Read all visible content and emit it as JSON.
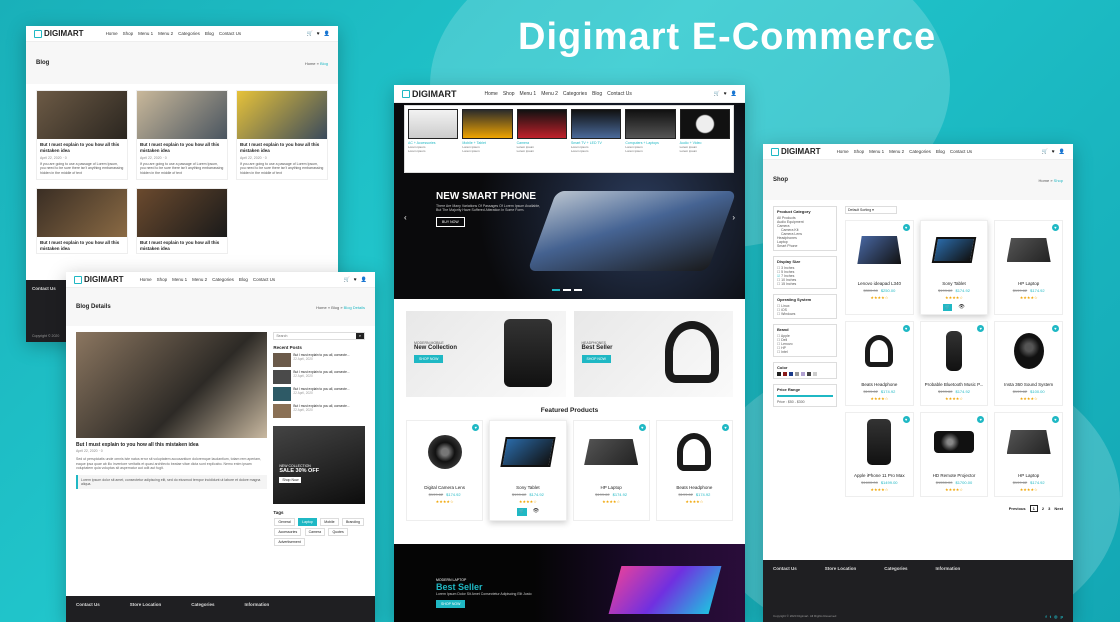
{
  "hero_title": "Digimart E-Commerce",
  "brand": "DIGIMART",
  "colors": {
    "accent": "#1fb8c4",
    "dark": "#1f1f22"
  },
  "nav": {
    "items": [
      "Home",
      "Shop",
      "Menu 1",
      "Menu 2",
      "Categories",
      "Blog",
      "Contact Us"
    ]
  },
  "blog_panel": {
    "heading": "Blog",
    "crumb_home": "Home",
    "crumb_current": "Blog",
    "post_title": "But I must explain to you how all this mistaken idea",
    "post_date": "April 22, 2020",
    "post_comments": "0",
    "post_excerpt": "If you are going to use a passage of Lorem Ipsum, you need to be sure there isn't anything embarrassing hidden in the middle of text",
    "footer_contact": "Contact Us",
    "copyright": "Copyright © 2020"
  },
  "detail_panel": {
    "heading": "Blog Details",
    "crumb_home": "Home",
    "crumb_mid": "Blog",
    "crumb_current": "Blog Details",
    "search_placeholder": "Search",
    "recent_posts_label": "Recent Posts",
    "recent_title": "But I must explain to you all, consecte...",
    "recent_date": "22 April, 2020",
    "post_title": "But I must explain to you how all this mistaken idea",
    "post_date": "April 22, 2020",
    "post_comments": "0",
    "body": "Sed ut perspiciatis unde omnis iste natus error sit voluptatem accusantium doloremque laudantium, totam rem aperiam, eaque ipsa quae ab illo inventore veritatis et quasi architecto beatae vitae dicta sunt explicabo. Nemo enim ipsam voluptatem quia voluptas sit aspernatur aut odit aut fugit.",
    "quote": "Lorem ipsum dolor sit amet, consectetur adipiscing elit, sed do eiusmod tempor incididunt ut labore et dolore magna aliqua.",
    "ad_small": "NEW COLLECTION",
    "ad_big": "SALE 30% OFF",
    "ad_btn": "Shop Now",
    "tags_label": "Tags",
    "tags": [
      "General",
      "Laptop",
      "Mobile",
      "Branding",
      "Accessories",
      "Camera",
      "Quotes",
      "Advertisement"
    ],
    "footer": [
      "Contact Us",
      "Store Location",
      "Categories",
      "Information"
    ]
  },
  "home_panel": {
    "mega": [
      "AC + Accessories",
      "Mobile + Tablet",
      "Camera",
      "Smart TV + LED TV",
      "Computers + Laptops",
      "Audio + Video"
    ],
    "mega_link": "Lorem ipsum",
    "slider_title": "NEW SMART PHONE",
    "slider_sub": "There Are Many Variations Of Passages Of Lorem Ipsum Available, But The Majority Have Suffered Alteration In Some Form.",
    "slider_btn": "BUY NOW",
    "promo1_small": "MODERN MOBILE",
    "promo1_big": "New Collection",
    "promo2_small": "HEADPHONES",
    "promo2_big": "Best Seller",
    "promo_btn": "SHOP NOW",
    "featured_label": "Featured Products",
    "products": [
      {
        "name": "Digital Camera Lens",
        "old": "$199.62",
        "price": "$174.92"
      },
      {
        "name": "Sony Tablet",
        "old": "$199.62",
        "price": "$174.92"
      },
      {
        "name": "HP Laptop",
        "old": "$199.62",
        "price": "$174.92"
      },
      {
        "name": "Beats Headphone",
        "old": "$199.62",
        "price": "$174.92"
      }
    ],
    "banner_small": "MODERN LAPTOP",
    "banner_big": "Best Seller",
    "banner_sub": "Lorem Ipsum Dolor Sit Amet Consectetur Adipiscing Elit Justo",
    "banner_btn": "SHOP NOW"
  },
  "shop_panel": {
    "heading": "Shop",
    "crumb_home": "Home",
    "crumb_current": "Shop",
    "sort": "Default Sorting",
    "filters": {
      "category": {
        "label": "Product Category",
        "items": [
          "All Products",
          "Audio Equipment",
          "Camera",
          "Camera Kit",
          "Camera Lens",
          "Headphones",
          "Laptop",
          "Smart Phone"
        ]
      },
      "display": {
        "label": "Display Size",
        "items": [
          "3 Inches",
          "5 Inches",
          "7 Inches",
          "10 Inches",
          "15 Inches"
        ]
      },
      "os": {
        "label": "Operating System",
        "items": [
          "Linux",
          "iOS",
          "Windows"
        ]
      },
      "brand": {
        "label": "Brand",
        "items": [
          "Apple",
          "Dell",
          "Lenovo",
          "HP",
          "Intel"
        ]
      },
      "color_label": "Color",
      "price_label": "Price Range",
      "price_value": "Price : $50 - $300"
    },
    "products": [
      {
        "name": "Lenovo ideapad L340",
        "old": "$300.00",
        "price": "$250.00"
      },
      {
        "name": "Sony Tablet",
        "old": "$199.62",
        "price": "$174.92"
      },
      {
        "name": "HP Laptop",
        "old": "$199.62",
        "price": "$174.92"
      },
      {
        "name": "Beats Headphone",
        "old": "$199.62",
        "price": "$174.92"
      },
      {
        "name": "Probable Bluetooth Music P...",
        "old": "$199.62",
        "price": "$174.92"
      },
      {
        "name": "Insta 360 Sound System",
        "old": "$199.62",
        "price": "$100.00"
      },
      {
        "name": "Apple iPhone 11 Pro Max",
        "old": "$1600.00",
        "price": "$1499.00"
      },
      {
        "name": "HD Remote Projector",
        "old": "$1550.00",
        "price": "$1700.00"
      },
      {
        "name": "HP Laptop",
        "old": "$199.62",
        "price": "$174.92"
      }
    ],
    "pagination": {
      "prev": "Previous",
      "pages": [
        "1",
        "2",
        "3"
      ],
      "next": "Next"
    },
    "footer": [
      "Contact Us",
      "Store Location",
      "Categories",
      "Information"
    ],
    "copyright": "Copyright © 2020 Digimart. All Rights Reserved"
  }
}
